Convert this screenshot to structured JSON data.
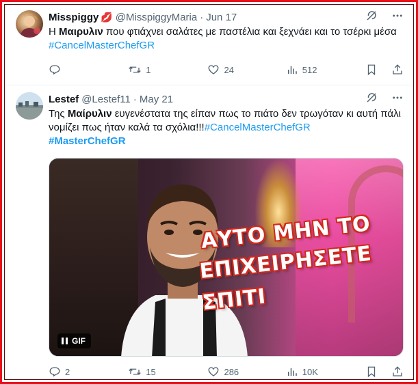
{
  "tweets": [
    {
      "display_name": "Misspiggy",
      "emoji": "💋",
      "handle": "@MisspiggyMaria",
      "date": "Jun 17",
      "text_prefix": "Η ",
      "text_bold": "Μαιρυλιν",
      "text_rest": " που φτιάχνει σαλάτες με παστέλια και ξεχνάει και το τσέρκι μέσα ",
      "hashtag1": "#CancelMasterChefGR",
      "hashtag2": "",
      "counts": {
        "reply": "",
        "retweet": "1",
        "like": "24",
        "views": "512"
      }
    },
    {
      "display_name": "Lestef",
      "handle": "@Lestef11",
      "date": "May 21",
      "text_prefix": "Της ",
      "text_bold": "Μαίρυλιν",
      "text_rest": " ευγενέστατα της είπαν πως το πιάτο δεν τρωγόταν κι αυτή πάλι νομίζει πως ήταν καλά τα σχόλια!!!",
      "hashtag1": "#CancelMasterChefGR",
      "hashtag2": "#MasterChefGR",
      "media": {
        "overlay_lines": [
          "ΑΥΤΟ ΜΗΝ ΤΟ",
          "ΕΠΙΧΕΙΡΗΣΕΤΕ",
          "ΣΠΙΤΙ"
        ],
        "gif_label": "GIF"
      },
      "counts": {
        "reply": "2",
        "retweet": "15",
        "like": "286",
        "views": "10K"
      }
    }
  ],
  "colors": {
    "frame": "#e8101a",
    "hashtag": "#1d9bf0",
    "muted": "#536471"
  },
  "icons": [
    "grok-icon",
    "more-icon",
    "reply-icon",
    "retweet-icon",
    "like-icon",
    "views-icon",
    "bookmark-icon",
    "share-icon",
    "pause-icon"
  ]
}
